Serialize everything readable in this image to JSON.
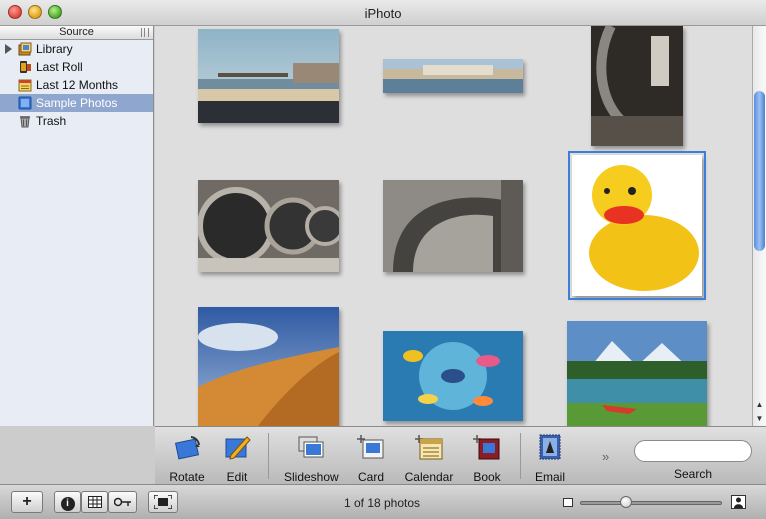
{
  "window": {
    "title": "iPhoto"
  },
  "sidebar": {
    "header": "Source",
    "items": [
      {
        "label": "Library",
        "icon": "library-icon"
      },
      {
        "label": "Last Roll",
        "icon": "film-roll-icon"
      },
      {
        "label": "Last 12 Months",
        "icon": "calendar-album-icon"
      },
      {
        "label": "Sample Photos",
        "icon": "album-icon",
        "selected": true
      },
      {
        "label": "Trash",
        "icon": "trash-icon"
      }
    ]
  },
  "photos": [
    {
      "subject": "pier-beach-photo"
    },
    {
      "subject": "coastal-town-panorama-photo"
    },
    {
      "subject": "washer-door-closeup-photo"
    },
    {
      "subject": "laundromat-washers-photo"
    },
    {
      "subject": "washer-door-curve-photo"
    },
    {
      "subject": "rubber-duck-photo",
      "selected": true
    },
    {
      "subject": "sand-dune-photo"
    },
    {
      "subject": "tropical-fish-photo"
    },
    {
      "subject": "mountain-lake-canoe-photo"
    }
  ],
  "toolbar": {
    "rotate": "Rotate",
    "edit": "Edit",
    "slideshow": "Slideshow",
    "card": "Card",
    "calendar": "Calendar",
    "book": "Book",
    "email": "Email",
    "more": "»",
    "search_label": "Search",
    "search_value": ""
  },
  "bottombar": {
    "add": "+",
    "info": "i",
    "count": "1 of 18 photos"
  },
  "colors": {
    "selection": "#8fa6cf",
    "photo_selection": "#3d7fd6",
    "scroll_thumb": "#5a8ede"
  }
}
